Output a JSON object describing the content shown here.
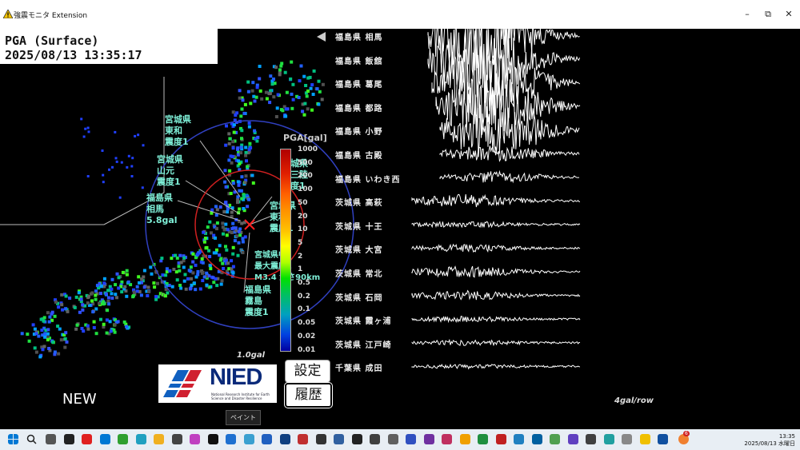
{
  "window": {
    "title": "強震モニタ Extension",
    "minimize": "–",
    "maximize": "⧉",
    "close": "✕"
  },
  "header": {
    "mode": "PGA (Surface)",
    "datetime": "2025/08/13 13:35:17"
  },
  "labels": [
    {
      "text": "宮城県\n東和\n震度1"
    },
    {
      "text": "宮城県\n山元\n震度1"
    },
    {
      "text": "福島県\n相馬\n5.8gal"
    },
    {
      "text": "宮城県\n南三陸\n震度1"
    },
    {
      "text": "宮城県\n東和\n震度1"
    },
    {
      "text": "宮城県中\n最大震度2\nM3.4 深さ90km"
    },
    {
      "text": "福島県\n霧島\n震度1"
    }
  ],
  "scale": {
    "title": "PGA[gal]",
    "ticks": [
      "1000",
      "500",
      "200",
      "100",
      "50",
      "20",
      "10",
      "5",
      "2",
      "1",
      "0.5",
      "0.2",
      "0.1",
      "0.05",
      "0.02",
      "0.01"
    ],
    "unit_map": "1.0gal",
    "unit_wave": "4gal/row"
  },
  "logo": {
    "name": "NIED",
    "sub": "National Research Institute for Earth Science and Disaster Resilience"
  },
  "buttons": {
    "settings": "設定",
    "history": "履歴"
  },
  "new_label": "NEW",
  "tooltip": "ペイント",
  "stations": [
    "福島県 相馬",
    "福島県 飯舘",
    "福島県 葛尾",
    "福島県 都路",
    "福島県 小野",
    "福島県 古殿",
    "福島県 いわき西",
    "茨城県 高萩",
    "茨城県 十王",
    "茨城県 大宮",
    "茨城県 常北",
    "茨城県 石岡",
    "茨城県 霞ヶ浦",
    "茨城県 江戸崎",
    "千葉県 成田"
  ],
  "taskbar": {
    "time": "13:35",
    "date": "2025/08/13 水曜日",
    "badge": "6"
  },
  "colors": {
    "epicenter": "#ff2020",
    "circle_outer": "#3040c0",
    "circle_inner": "#d02020"
  }
}
